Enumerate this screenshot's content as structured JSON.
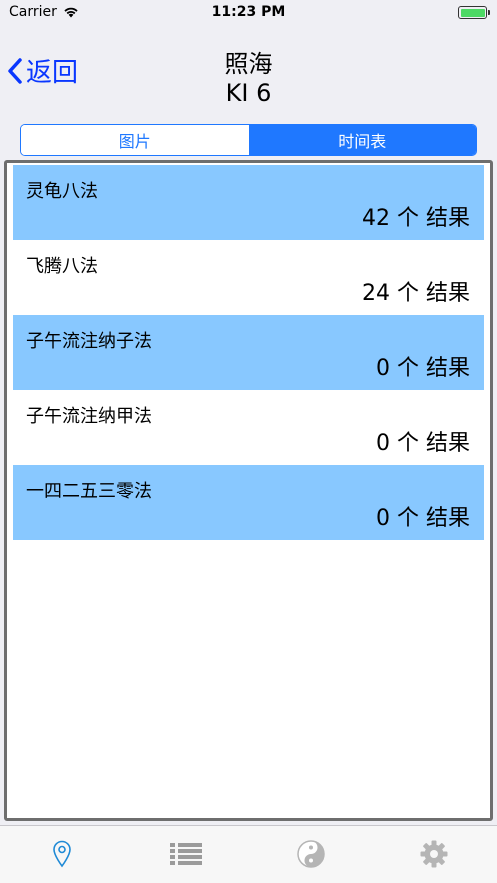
{
  "status_bar": {
    "carrier": "Carrier",
    "time": "11:23 PM",
    "battery_level": 1.0,
    "battery_color": "#4cd964"
  },
  "nav": {
    "back_label": "返回",
    "title_line1": "照海",
    "title_line2": "KI 6",
    "accent_color": "#0a37ff"
  },
  "segments": {
    "items": [
      "图片",
      "时间表"
    ],
    "selected": "时间表",
    "color": "#1f78ff"
  },
  "results": {
    "rows": [
      {
        "name": "灵龟八法",
        "count": "42 个 结果"
      },
      {
        "name": "飞腾八法",
        "count": "24 个 结果"
      },
      {
        "name": "子午流注纳子法",
        "count": "0 个 结果"
      },
      {
        "name": "子午流注纳甲法",
        "count": "0 个 结果"
      },
      {
        "name": "一四二五三零法",
        "count": "0 个 结果"
      }
    ],
    "highlight_color": "#88c8ff"
  },
  "tab_bar": {
    "items": [
      {
        "icon": "location-pin-icon",
        "selected": true
      },
      {
        "icon": "list-icon",
        "selected": false
      },
      {
        "icon": "yin-yang-icon",
        "selected": false
      },
      {
        "icon": "gear-icon",
        "selected": false
      }
    ]
  }
}
